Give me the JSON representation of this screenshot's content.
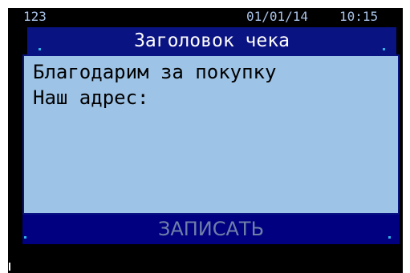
{
  "status_bar": {
    "left_text": "123",
    "date": "01/01/14",
    "time": "10:15"
  },
  "header": {
    "title": "Заголовок чека"
  },
  "receipt_body": {
    "lines": [
      "Благодарим за покупку",
      "Наш адрес:"
    ]
  },
  "footer": {
    "action_label": "ЗАПИСАТЬ"
  },
  "colors": {
    "background": "#000000",
    "status_text": "#a9c3e8",
    "header_bg": "#0a1382",
    "body_bg": "#9dc3e6",
    "footer_bg": "#000080",
    "footer_text": "#6e7fa8",
    "corner_dot": "#2fb2e8"
  }
}
